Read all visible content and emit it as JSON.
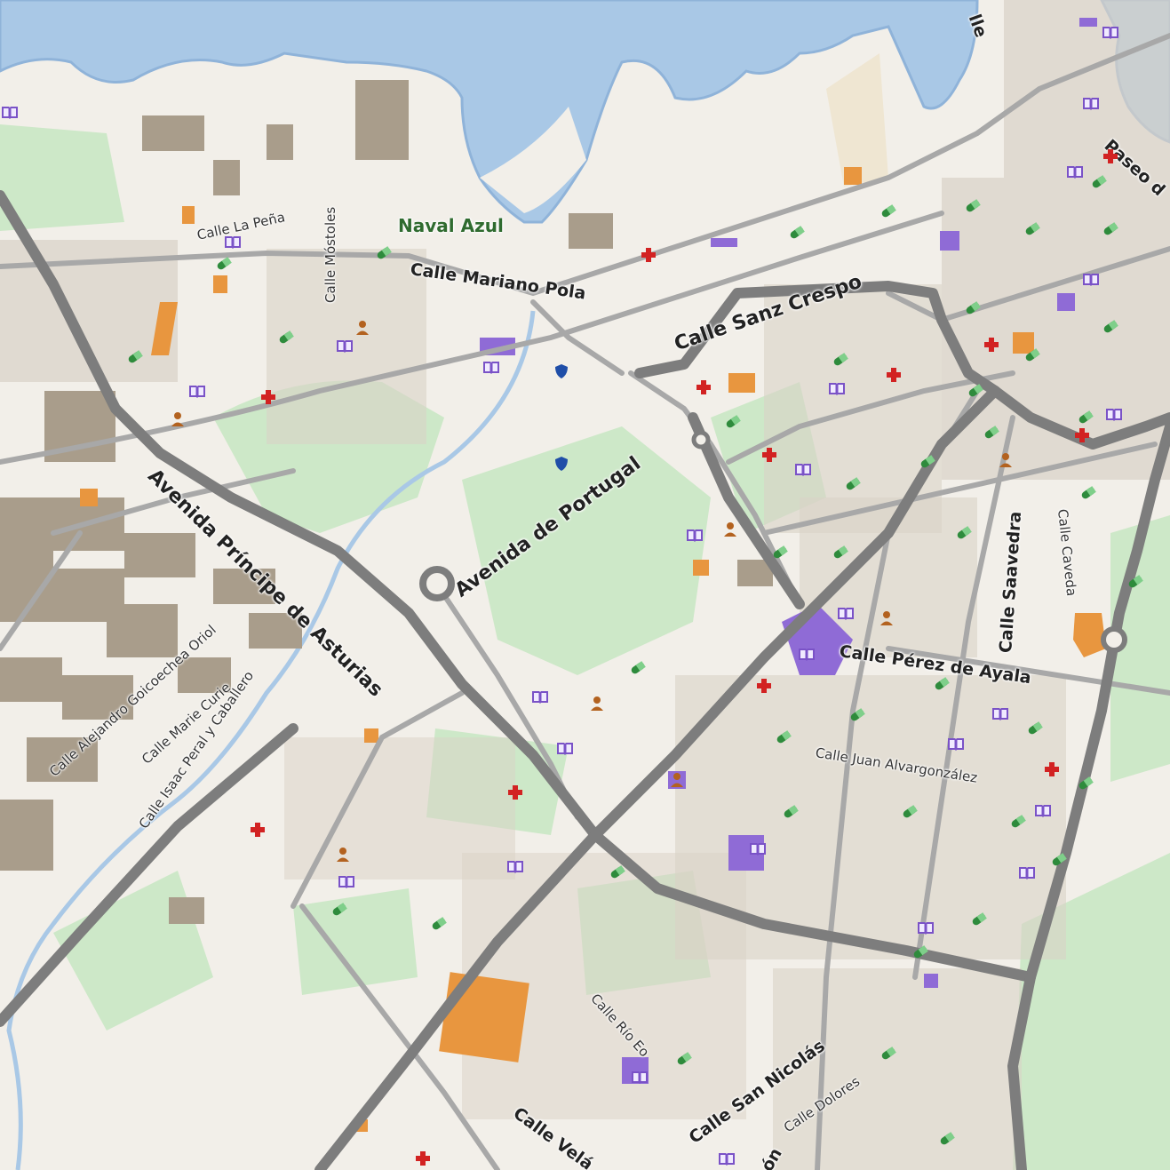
{
  "map": {
    "colors": {
      "water": "#a9c8e6",
      "water_edge": "#8fb3d9",
      "land": "#f2efe9",
      "park": "#cde8c8",
      "building": "#d9d2c6",
      "industrial": "#a99d8b",
      "highway": "#7d7d7d",
      "road": "#a8a8a8",
      "accent_orange": "#e8963f",
      "accent_purple": "#8f6bd6",
      "pharmacy_green": "#2e8b3c",
      "hospital_red": "#d22222",
      "police_blue": "#1f4ea8"
    },
    "labels": {
      "avenida_principe": "Avenida Príncipe de Asturias",
      "avenida_portugal": "Avenida de Portugal",
      "calle_mariano_pola": "Calle Mariano Pola",
      "calle_sanz_crespo": "Calle Sanz Crespo",
      "calle_la_pena": "Calle La Peña",
      "calle_mostoles": "Calle Móstoles",
      "naval_azul": "Naval Azul",
      "calle_saavedra": "Calle Saavedra",
      "calle_caveda": "Calle Caveda",
      "calle_perez_ayala": "Calle Pérez de Ayala",
      "calle_juan_alvargonzalez": "Calle Juan Alvargonzález",
      "calle_goicoechea": "Calle Alejandro Goicoechea Oriol",
      "calle_marie_curie": "Calle Marie Curie",
      "calle_isaac_peral": "Calle Isaac Peral y Caballero",
      "calle_rio_eo": "Calle Río Eo",
      "calle_san_nicolas": "Calle San Nicolás",
      "calle_dolores": "Calle Dolores",
      "calle_velazquez_partial": "Calle Velá",
      "paseo_partial": "Paseo d",
      "calle_partial_top": "lle",
      "calle_partial_bottom": "ón"
    },
    "icons": {
      "pharmacy": "pharmacy-pill-icon",
      "hospital": "hospital-cross-icon",
      "library": "library-book-icon",
      "social": "social-facility-person-icon",
      "police": "police-shield-icon"
    }
  }
}
